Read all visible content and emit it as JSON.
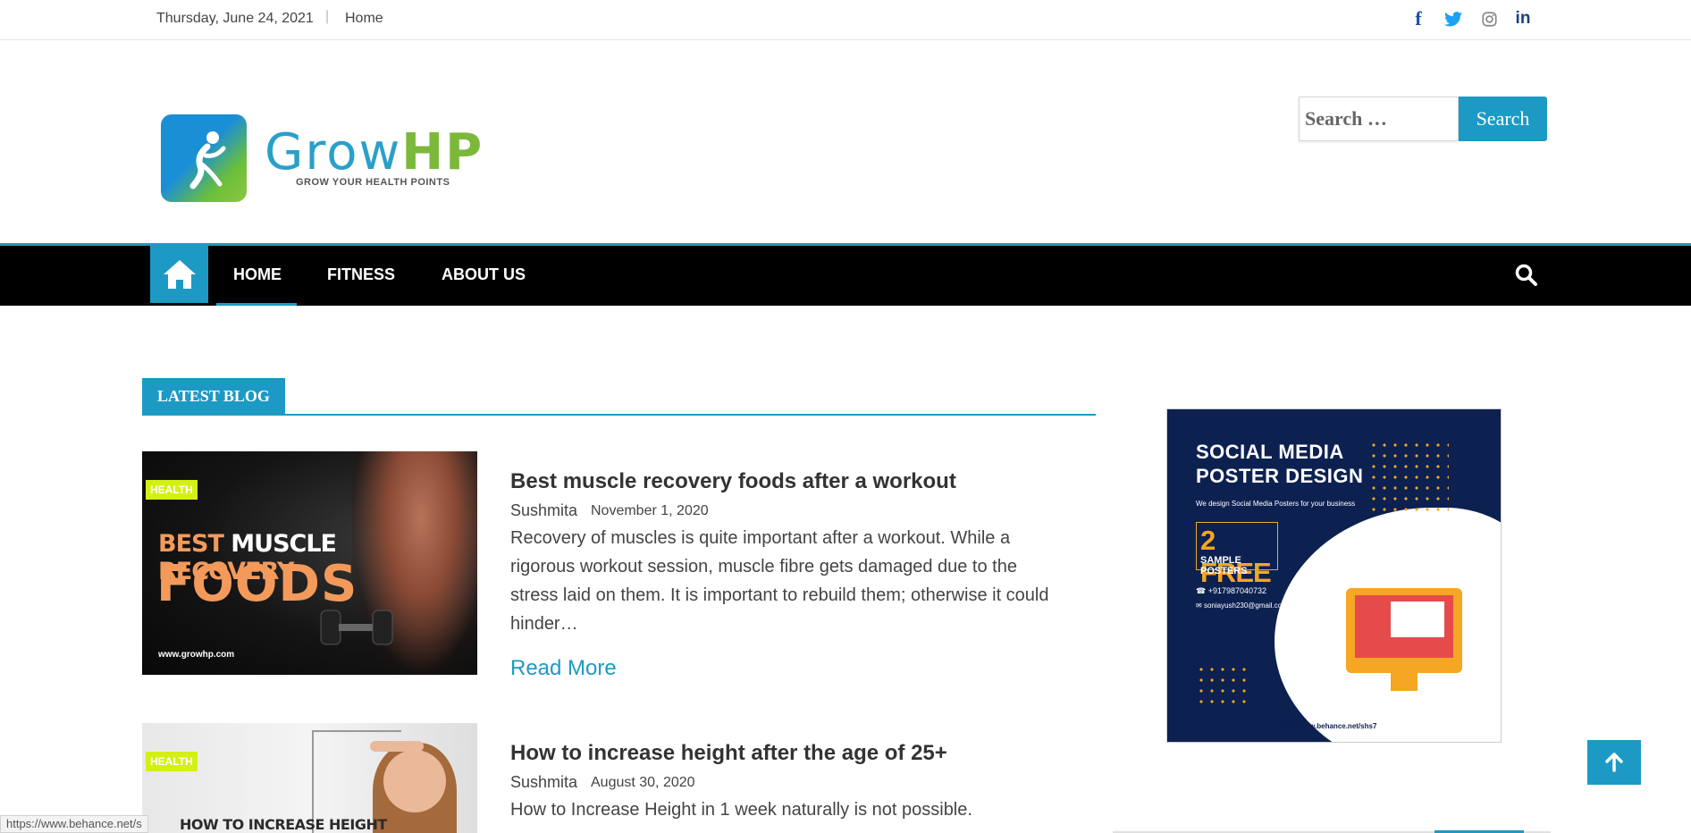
{
  "topbar": {
    "date": "Thursday, June 24, 2021",
    "separator": "|",
    "home_link": "Home",
    "social": [
      {
        "icon": "facebook-icon",
        "glyph": "f",
        "color": "#1b4fb1"
      },
      {
        "icon": "twitter-icon",
        "color": "#1da1f2"
      },
      {
        "icon": "instagram-icon",
        "color": "#888888"
      },
      {
        "icon": "linkedin-icon",
        "glyph": "in",
        "color": "#10457f"
      }
    ]
  },
  "header": {
    "logo": {
      "word_grow": "Grow",
      "word_hp": "HP",
      "tagline": "GROW YOUR HEALTH POINTS"
    },
    "search": {
      "placeholder": "Search …",
      "button": "Search"
    }
  },
  "nav": {
    "items": [
      "HOME",
      "FITNESS",
      "ABOUT US"
    ],
    "active": "HOME"
  },
  "main": {
    "section_title": "LATEST BLOG",
    "posts": [
      {
        "category": "HEALTH",
        "image_text": {
          "line1_a": "BEST ",
          "line1_b": "MUSCLE ",
          "line1_c": "RECOVERY",
          "line2": "FOODS",
          "url": "www.growhp.com"
        },
        "title": "Best muscle recovery foods after a workout",
        "author": "Sushmita",
        "date": "November 1, 2020",
        "excerpt": "Recovery of muscles is quite important after a workout. While a rigorous workout session, muscle fibre gets damaged due to the stress laid on them. It is important to rebuild them; otherwise it could hinder…",
        "read_more": "Read More"
      },
      {
        "category": "HEALTH",
        "image_text": {
          "line1": "HOW TO INCREASE HEIGHT"
        },
        "title": "How to increase height after the age of 25+",
        "author": "Sushmita",
        "date": "August 30, 2020",
        "excerpt": "How to Increase Height in 1 week naturally is not possible."
      }
    ]
  },
  "sidebar": {
    "ad": {
      "title_line1": "SOCIAL MEDIA",
      "title_line2": "POSTER DESIGN",
      "subtitle": "We design Social Media Posters for your business",
      "free_count": "2 FREE",
      "free_label": "SAMPLE POSTERS",
      "phone": "+917987040732",
      "email": "soniayush230@gmail.com",
      "url": "https://www.behance.net/shs7"
    }
  },
  "status_bar": "https://www.behance.net/s",
  "colors": {
    "accent": "#1c9ac4",
    "nav_bg": "#000000",
    "badge": "#d4f012"
  }
}
